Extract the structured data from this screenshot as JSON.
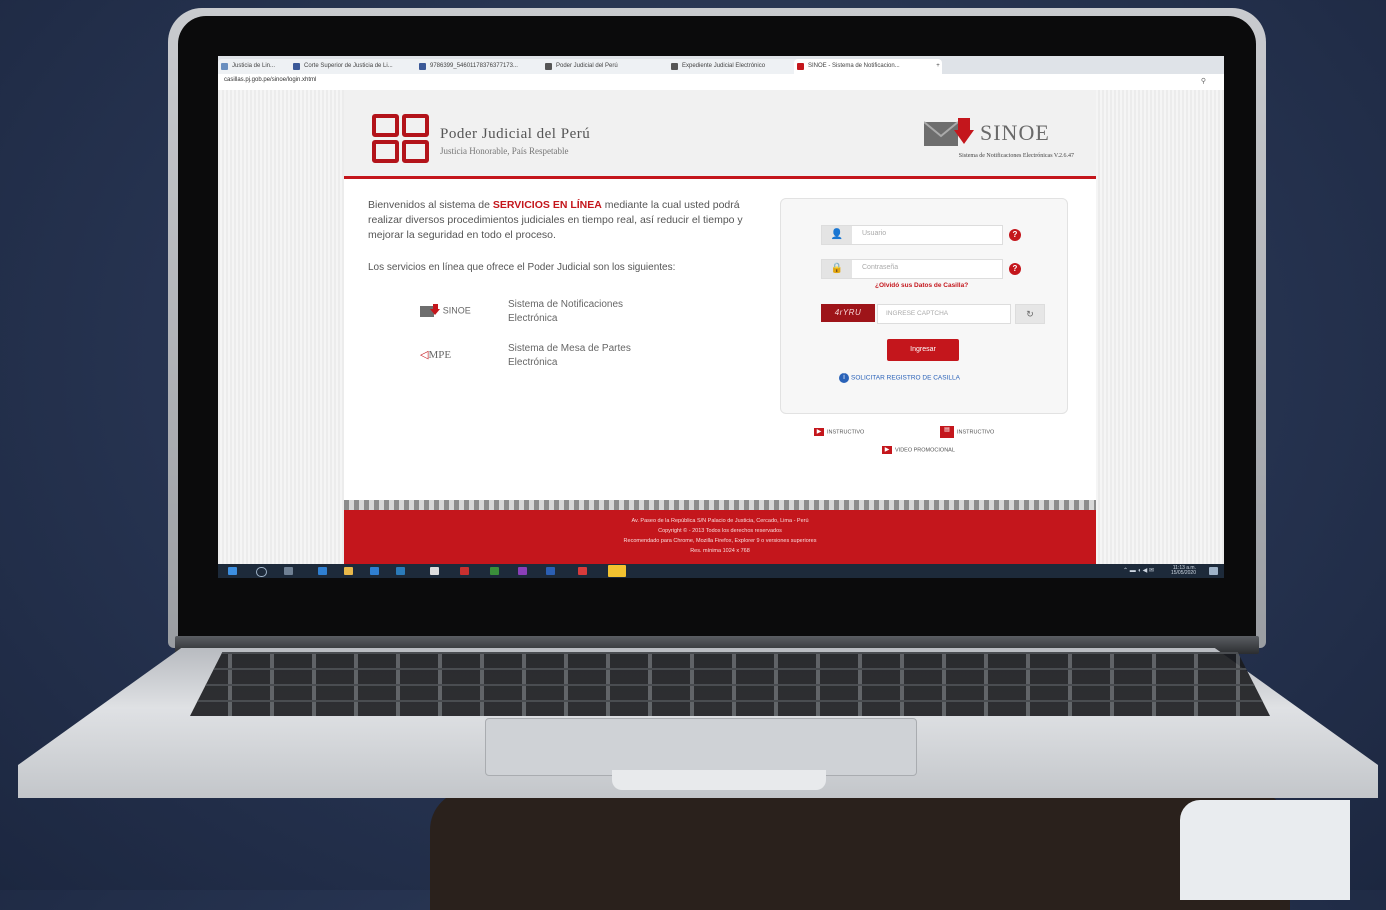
{
  "browser": {
    "tabs": [
      {
        "label": "Justicia de Lin...",
        "favicon_color": "#6a8fbf"
      },
      {
        "label": "Corte Superior de Justicia de Li...",
        "favicon_color": "#3b5998"
      },
      {
        "label": "9786399_54601178376377173...",
        "favicon_color": "#3b5998"
      },
      {
        "label": "Poder Judicial del Perú",
        "favicon_color": "#555555"
      },
      {
        "label": "Expediente Judicial Electrónico",
        "favicon_color": "#555555"
      },
      {
        "label": "SINOE - Sistema de Notificacion...",
        "favicon_color": "#c4161c"
      }
    ],
    "address": "casillas.pj.gob.pe/sinoe/login.xhtml"
  },
  "header": {
    "org_name": "Poder Judicial del Perú",
    "motto": "Justicia Honorable, País Respetable",
    "system_name": "SINOE",
    "system_subtitle": "Sistema de Notificaciones Electrónicas V.2.6.47"
  },
  "main": {
    "welcome_pre": "Bienvenidos al sistema de ",
    "welcome_highlight": "SERVICIOS EN LÍNEA",
    "welcome_post": " mediante la cual usted podrá realizar diversos procedimientos judiciales en tiempo real, así reducir el tiempo y mejorar la seguridad en todo el proceso.",
    "services_intro": "Los servicios en línea que ofrece el Poder Judicial son los siguientes:",
    "services": [
      {
        "logo": "SINOE",
        "name": "Sistema de Notificaciones Electrónica"
      },
      {
        "logo": "MPE",
        "name": "Sistema de Mesa de Partes Electrónica"
      }
    ]
  },
  "login": {
    "user_placeholder": "Usuario",
    "password_placeholder": "Contraseña",
    "forgot_link": "¿Olvidó sus Datos de Casilla?",
    "captcha_text": "4rYRU",
    "captcha_placeholder": "INGRESE CAPTCHA",
    "submit_label": "Ingresar",
    "register_link": "SOLICITAR REGISTRO DE CASILLA"
  },
  "links": {
    "instructivo_1": "INSTRUCTIVO",
    "instructivo_2": "INSTRUCTIVO",
    "video": "VIDEO PROMOCIONAL"
  },
  "footer": {
    "address": "Av. Paseo de la República S/N Palacio de Justicia, Cercado, Lima - Perú",
    "copyright": "Copyright © - 2013 Todos los derechos reservados",
    "browsers": "Recomendado para Chrome, Mozilla Firefox, Explorer 9 o versiones superiores",
    "resolution": "Res. mínima 1024 x 768"
  },
  "taskbar": {
    "time": "11:13 a.m.",
    "date": "15/05/2020"
  },
  "colors": {
    "brand_red": "#c4161c",
    "link_blue": "#2a62b8"
  }
}
